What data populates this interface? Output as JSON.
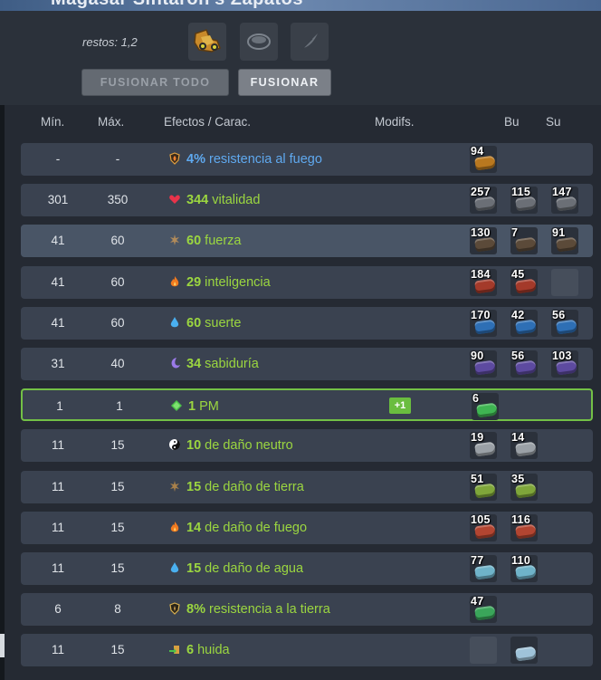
{
  "header": {
    "title": "Magasar Sintaron's Zapatos"
  },
  "panel": {
    "restos": "restos: 1,2",
    "slots": [
      "boots-item-icon",
      "rune-slot-icon",
      "feather-icon"
    ],
    "buttons": {
      "fuse_all": "FUSIONAR TODO",
      "fuse": "FUSIONAR"
    }
  },
  "table": {
    "headers": {
      "min": "Mín.",
      "max": "Máx.",
      "effects": "Efectos / Carac.",
      "mods": "Modifs.",
      "bu": "Bu",
      "su": "Su"
    },
    "rows": [
      {
        "min": "-",
        "max": "-",
        "icon": "fire-resist-shield-icon",
        "value": "4%",
        "label": "resistencia al fuego",
        "color": "blue",
        "runes": [
          {
            "n": "94",
            "c": "#b9781f"
          },
          null,
          null
        ]
      },
      {
        "min": "301",
        "max": "350",
        "icon": "heart-icon",
        "value": "344",
        "label": "vitalidad",
        "color": "green",
        "runes": [
          {
            "n": "257",
            "c": "#6b6f76"
          },
          {
            "n": "115",
            "c": "#6b6f76"
          },
          {
            "n": "147",
            "c": "#6b6f76"
          }
        ]
      },
      {
        "min": "41",
        "max": "60",
        "icon": "strength-icon",
        "value": "60",
        "label": "fuerza",
        "color": "green",
        "runes": [
          {
            "n": "130",
            "c": "#5b4a39"
          },
          {
            "n": "7",
            "c": "#5b4a39"
          },
          {
            "n": "91",
            "c": "#5b4a39"
          }
        ],
        "hl": true
      },
      {
        "min": "41",
        "max": "60",
        "icon": "fire-icon",
        "value": "29",
        "label": "inteligencia",
        "color": "green",
        "runes": [
          {
            "n": "184",
            "c": "#a43a2a"
          },
          {
            "n": "45",
            "c": "#a43a2a"
          },
          "empty"
        ]
      },
      {
        "min": "41",
        "max": "60",
        "icon": "water-drop-icon",
        "value": "60",
        "label": "suerte",
        "color": "green",
        "runes": [
          {
            "n": "170",
            "c": "#2e6fb5"
          },
          {
            "n": "42",
            "c": "#2e6fb5"
          },
          {
            "n": "56",
            "c": "#2e6fb5"
          }
        ]
      },
      {
        "min": "31",
        "max": "40",
        "icon": "moon-icon",
        "value": "34",
        "label": "sabiduría",
        "color": "green",
        "runes": [
          {
            "n": "90",
            "c": "#5d4aa0"
          },
          {
            "n": "56",
            "c": "#5d4aa0"
          },
          {
            "n": "103",
            "c": "#5d4aa0"
          }
        ]
      },
      {
        "min": "1",
        "max": "1",
        "icon": "pm-diamond-icon",
        "value": "1",
        "label": "PM",
        "color": "green",
        "mod": "+1",
        "runes": [
          {
            "n": "6",
            "c": "#3fb552"
          },
          null,
          null
        ],
        "pm": true
      },
      {
        "min": "11",
        "max": "15",
        "icon": "yin-yang-icon",
        "value": "10",
        "label": "de daño neutro",
        "color": "green",
        "runes": [
          {
            "n": "19",
            "c": "#9aa0a6"
          },
          {
            "n": "14",
            "c": "#9aa0a6"
          },
          null
        ]
      },
      {
        "min": "11",
        "max": "15",
        "icon": "earth-icon",
        "value": "15",
        "label": "de daño de tierra",
        "color": "green",
        "runes": [
          {
            "n": "51",
            "c": "#7fa63a"
          },
          {
            "n": "35",
            "c": "#7fa63a"
          },
          null
        ]
      },
      {
        "min": "11",
        "max": "15",
        "icon": "fire-icon",
        "value": "14",
        "label": "de daño de fuego",
        "color": "green",
        "runes": [
          {
            "n": "105",
            "c": "#b24531"
          },
          {
            "n": "116",
            "c": "#b24531"
          },
          null
        ]
      },
      {
        "min": "11",
        "max": "15",
        "icon": "water-drop-icon",
        "value": "15",
        "label": "de daño de agua",
        "color": "green",
        "runes": [
          {
            "n": "77",
            "c": "#6fb3c9"
          },
          {
            "n": "110",
            "c": "#6fb3c9"
          },
          null
        ]
      },
      {
        "min": "6",
        "max": "8",
        "icon": "earth-resist-shield-icon",
        "value": "8%",
        "label": "resistencia a la tierra",
        "color": "green",
        "runes": [
          {
            "n": "47",
            "c": "#3aa55a"
          },
          null,
          null
        ]
      },
      {
        "min": "11",
        "max": "15",
        "icon": "escape-icon",
        "value": "6",
        "label": "huida",
        "color": "green",
        "runes": [
          "empty",
          {
            "n": "",
            "c": "#9fc3d9"
          },
          null
        ]
      }
    ]
  }
}
